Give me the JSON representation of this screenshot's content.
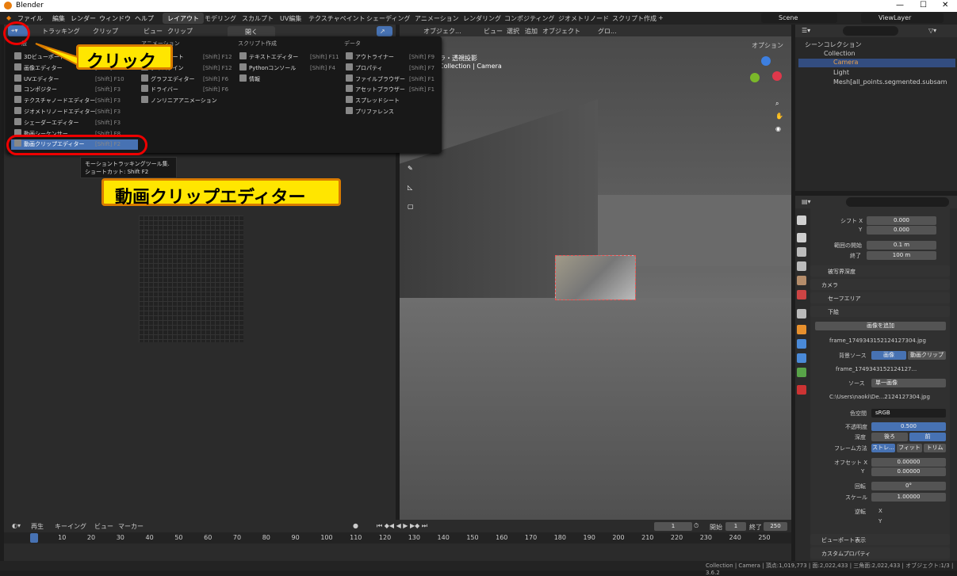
{
  "window": {
    "title": "Blender",
    "minimize": "—",
    "maximize": "☐",
    "close": "✕"
  },
  "menubar": {
    "items": [
      "ファイル",
      "編集",
      "レンダー",
      "ウィンドウ",
      "ヘルプ"
    ],
    "workspaces": [
      "レイアウト",
      "モデリング",
      "スカルプト",
      "UV編集",
      "テクスチャペイント",
      "シェーディング",
      "アニメーション",
      "レンダリング",
      "コンポジティング",
      "ジオメトリノード",
      "スクリプト作成",
      "+"
    ],
    "scene": "Scene",
    "view_layer": "ViewLayer"
  },
  "left_header": {
    "tracking": "トラッキング",
    "clip": "クリップ",
    "view": "ビュー",
    "clip2": "クリップ",
    "open": "開く"
  },
  "viewport_header": {
    "mode": "オブジェク...",
    "view": "ビュー",
    "select": "選択",
    "add": "追加",
    "object": "オブジェクト",
    "transform": "グロ...",
    "options": "オプション",
    "overlay_title": "ラ・透視投影",
    "overlay_sub": "Collection | Camera"
  },
  "menu": {
    "headers": [
      "一般",
      "アニメーション",
      "スクリプト作成",
      "データ"
    ],
    "general": [
      {
        "label": "3Dビューポート",
        "sc": "[Shift] F5"
      },
      {
        "label": "画像エディター",
        "sc": "[Shift] F10"
      },
      {
        "label": "UVエディター",
        "sc": "[Shift] F10"
      },
      {
        "label": "コンポジター",
        "sc": "[Shift] F3"
      },
      {
        "label": "テクスチャノードエディター",
        "sc": "[Shift] F3"
      },
      {
        "label": "ジオメトリノードエディター",
        "sc": "[Shift] F3"
      },
      {
        "label": "シェーダーエディター",
        "sc": "[Shift] F3"
      },
      {
        "label": "動画シーケンサー",
        "sc": "[Shift] F8"
      },
      {
        "label": "動画クリップエディター",
        "sc": "[Shift] F2"
      }
    ],
    "animation": [
      {
        "label": "ドープシート",
        "sc": "[Shift] F12"
      },
      {
        "label": "タイムライン",
        "sc": "[Shift] F12"
      },
      {
        "label": "グラフエディター",
        "sc": "[Shift] F6"
      },
      {
        "label": "ドライバー",
        "sc": "[Shift] F6"
      },
      {
        "label": "ノンリニアアニメーション",
        "sc": ""
      }
    ],
    "scripting": [
      {
        "label": "テキストエディター",
        "sc": "[Shift] F11"
      },
      {
        "label": "Pythonコンソール",
        "sc": "[Shift] F4"
      },
      {
        "label": "情報",
        "sc": ""
      }
    ],
    "data": [
      {
        "label": "アウトライナー",
        "sc": "[Shift] F9"
      },
      {
        "label": "プロパティ",
        "sc": "[Shift] F7"
      },
      {
        "label": "ファイルブラウザー",
        "sc": "[Shift] F1"
      },
      {
        "label": "アセットブラウザー",
        "sc": "[Shift] F1"
      },
      {
        "label": "スプレッドシート",
        "sc": ""
      },
      {
        "label": "プリファレンス",
        "sc": ""
      }
    ]
  },
  "tooltip": {
    "line1": "モーショントラッキングツール集.",
    "line2": "ショートカット: Shift F2"
  },
  "callouts": {
    "click": "クリック",
    "editor": "動画クリップエディター"
  },
  "outliner": {
    "root": "シーンコレクション",
    "items": [
      "Collection",
      "Camera",
      "Light",
      "Mesh[all_points.segmented.subsam"
    ]
  },
  "props": {
    "shift_x_label": "シフト X",
    "shift_x": "0.000",
    "y_label": "Y",
    "shift_y": "0.000",
    "clip_start_label": "範囲の開始",
    "clip_start": "0.1 m",
    "clip_end_label": "終了",
    "clip_end": "100 m",
    "sections": [
      "被写界深度",
      "カメラ",
      "セーフエリア",
      "下絵"
    ],
    "add_image": "画像を追加",
    "frame_name": "frame_1749343152124127304.jpg",
    "bg_source_label": "背景ソース",
    "bg_image": "画像",
    "bg_clip": "動画クリップ",
    "image_name": "frame_1749343152124127...",
    "source_label": "ソース",
    "source": "単一画像",
    "path": "C:\\Users\\naoki\\De...2124127304.jpg",
    "colorspace_label": "色空間",
    "colorspace": "sRGB",
    "opacity_label": "不透明度",
    "opacity": "0.500",
    "depth_label": "深度",
    "depth_back": "後ろ",
    "depth_front": "前",
    "frame_method_label": "フレーム方法",
    "fm1": "ストレ...",
    "fm2": "フィット",
    "fm3": "トリム",
    "offset_x_label": "オフセット X",
    "offset_x": "0.00000",
    "offset_y_label": "Y",
    "offset_y": "0.00000",
    "rotation_label": "回転",
    "rotation": "0°",
    "scale_label": "スケール",
    "scale": "1.00000",
    "flip_label": "逆転",
    "flip_x": "X",
    "flip_y": "Y",
    "viewport_display": "ビューポート表示",
    "custom_props": "カスタムプロパティ"
  },
  "timeline": {
    "play": "再生",
    "keying": "キーイング",
    "view": "ビュー",
    "marker": "マーカー",
    "current": "1",
    "start_label": "開始",
    "start": "1",
    "end_label": "終了",
    "end": "250",
    "ticks": [
      "1",
      "10",
      "20",
      "30",
      "40",
      "50",
      "60",
      "70",
      "80",
      "90",
      "100",
      "110",
      "120",
      "130",
      "140",
      "150",
      "160",
      "170",
      "180",
      "190",
      "200",
      "210",
      "220",
      "230",
      "240",
      "250"
    ]
  },
  "status": "Collection | Camera | 頂点:1,019,773 | 面:2,022,433 | 三角面:2,022,433 | オブジェクト:1/3 | 3.6.2"
}
